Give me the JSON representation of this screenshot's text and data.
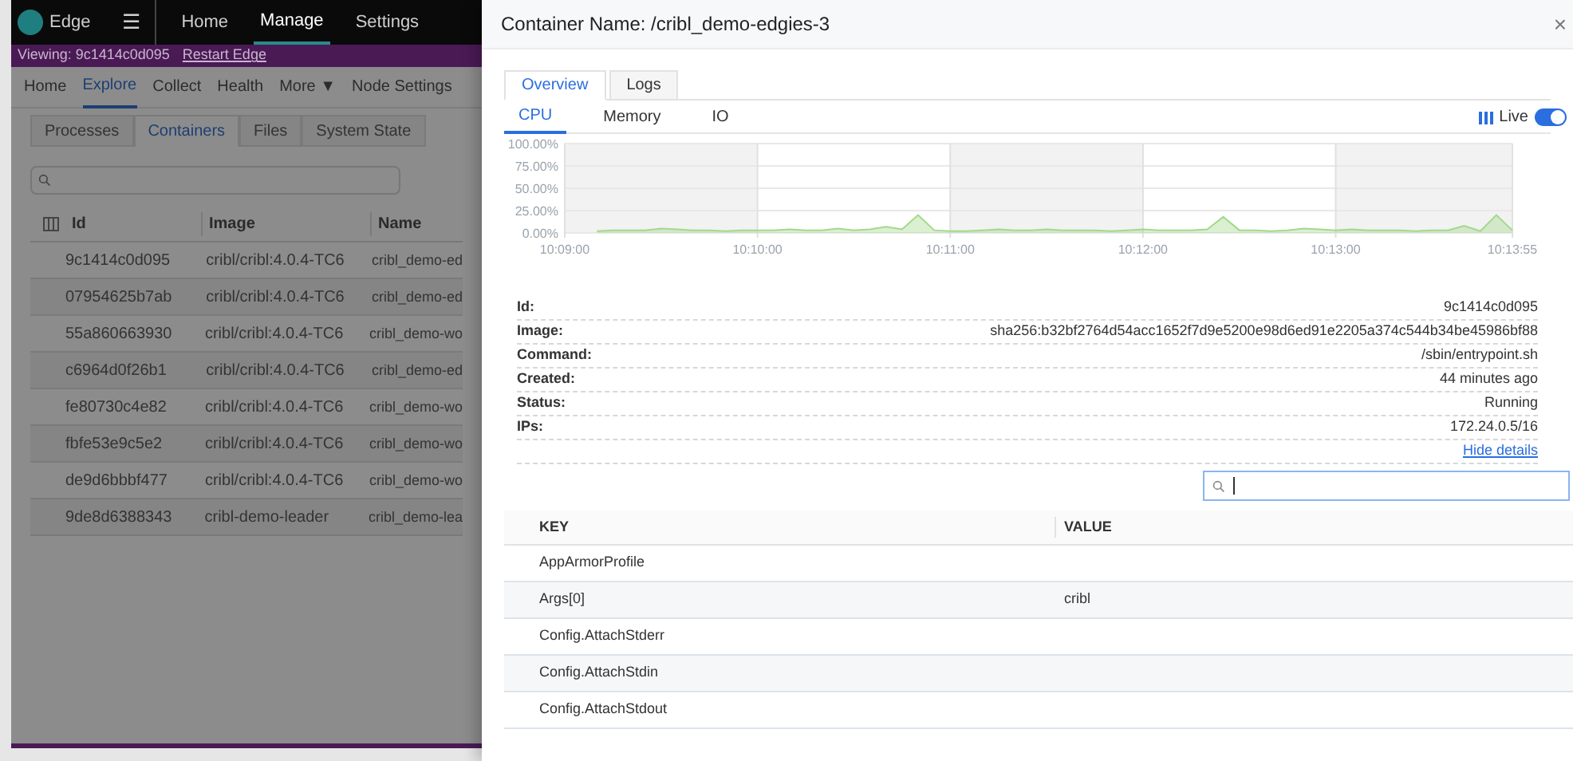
{
  "topbar": {
    "brand": "Edge",
    "menu_icon": "☰",
    "links": [
      {
        "label": "Home",
        "selected": false
      },
      {
        "label": "Manage",
        "selected": true
      },
      {
        "label": "Settings",
        "selected": false
      }
    ]
  },
  "viewing_bar": {
    "text": "Viewing: 9c1414c0d095",
    "link": "Restart Edge"
  },
  "nav": [
    {
      "label": "Home",
      "selected": false
    },
    {
      "label": "Explore",
      "selected": true
    },
    {
      "label": "Collect",
      "selected": false
    },
    {
      "label": "Health",
      "selected": false
    },
    {
      "label": "More ▼",
      "selected": false
    },
    {
      "label": "Node Settings",
      "selected": false
    }
  ],
  "subtabs": [
    {
      "label": "Processes",
      "selected": false
    },
    {
      "label": "Containers",
      "selected": true
    },
    {
      "label": "Files",
      "selected": false
    },
    {
      "label": "System State",
      "selected": false
    }
  ],
  "containers_table": {
    "columns": [
      "Id",
      "Image",
      "Name"
    ],
    "rows": [
      [
        "9c1414c0d095",
        "cribl/cribl:4.0.4-TC6",
        "cribl_demo-ed"
      ],
      [
        "07954625b7ab",
        "cribl/cribl:4.0.4-TC6",
        "cribl_demo-ed"
      ],
      [
        "55a860663930",
        "cribl/cribl:4.0.4-TC6",
        "cribl_demo-wo"
      ],
      [
        "c6964d0f26b1",
        "cribl/cribl:4.0.4-TC6",
        "cribl_demo-ed"
      ],
      [
        "fe80730c4e82",
        "cribl/cribl:4.0.4-TC6",
        "cribl_demo-wo"
      ],
      [
        "fbfe53e9c5e2",
        "cribl/cribl:4.0.4-TC6",
        "cribl_demo-wo"
      ],
      [
        "de9d6bbbf477",
        "cribl/cribl:4.0.4-TC6",
        "cribl_demo-wo"
      ],
      [
        "9de8d6388343",
        "cribl-demo-leader",
        "cribl_demo-lea"
      ]
    ]
  },
  "drawer": {
    "title": "Container Name: /cribl_demo-edgies-3",
    "close": "×",
    "tabs": [
      {
        "label": "Overview",
        "selected": true
      },
      {
        "label": "Logs",
        "selected": false
      }
    ],
    "metric_tabs": [
      {
        "label": "CPU",
        "selected": true
      },
      {
        "label": "Memory",
        "selected": false
      },
      {
        "label": "IO",
        "selected": false
      }
    ],
    "live": {
      "label": "Live",
      "on": true
    },
    "chart_data": {
      "type": "area",
      "categories": [
        "10:09:00",
        null,
        null,
        null,
        null,
        null,
        null,
        null,
        null,
        null,
        null,
        null,
        "10:10:00",
        null,
        null,
        null,
        null,
        null,
        null,
        null,
        null,
        null,
        null,
        null,
        "10:11:00",
        null,
        null,
        null,
        null,
        null,
        null,
        null,
        null,
        null,
        null,
        null,
        "10:12:00",
        null,
        null,
        null,
        null,
        null,
        null,
        null,
        null,
        null,
        null,
        null,
        "10:13:00",
        null,
        null,
        null,
        null,
        null,
        null,
        null,
        null,
        null,
        null,
        "10:13:55"
      ],
      "series": [
        {
          "color": "#a3d98b",
          "values": [
            null,
            null,
            2,
            3,
            3,
            3,
            5,
            4,
            3,
            3,
            2,
            3,
            3,
            3,
            4,
            3,
            3,
            5,
            3,
            4,
            7,
            4,
            20,
            3,
            2,
            2,
            3,
            4,
            3,
            3,
            4,
            3,
            3,
            3,
            2,
            3,
            4,
            3,
            3,
            3,
            4,
            18,
            3,
            3,
            2,
            3,
            5,
            4,
            3,
            4,
            3,
            3,
            3,
            2,
            3,
            3,
            8,
            2,
            20,
            3
          ]
        }
      ],
      "grid": true,
      "yticks": [
        {
          "value": 0,
          "label": "0.00%"
        },
        {
          "value": 25,
          "label": "25.00%"
        },
        {
          "value": 50,
          "label": "50.00%"
        },
        {
          "value": 75,
          "label": "75.00%"
        },
        {
          "value": 100,
          "label": "100.00%"
        }
      ],
      "ylim": [
        0,
        100
      ]
    },
    "details": [
      {
        "label": "Id:",
        "value": "9c1414c0d095"
      },
      {
        "label": "Image:",
        "value": "sha256:b32bf2764d54acc1652f7d9e5200e98d6ed91e2205a374c544b34be45986bf88"
      },
      {
        "label": "Command:",
        "value": "/sbin/entrypoint.sh"
      },
      {
        "label": "Created:",
        "value": "44 minutes ago"
      },
      {
        "label": "Status:",
        "value": "Running"
      },
      {
        "label": "IPs:",
        "value": "172.24.0.5/16"
      }
    ],
    "hide_details": "Hide details",
    "kv_table": {
      "columns": [
        "KEY",
        "VALUE"
      ],
      "rows": [
        [
          "AppArmorProfile",
          ""
        ],
        [
          "Args[0]",
          "cribl"
        ],
        [
          "Config.AttachStderr",
          ""
        ],
        [
          "Config.AttachStdin",
          ""
        ],
        [
          "Config.AttachStdout",
          ""
        ]
      ]
    }
  }
}
